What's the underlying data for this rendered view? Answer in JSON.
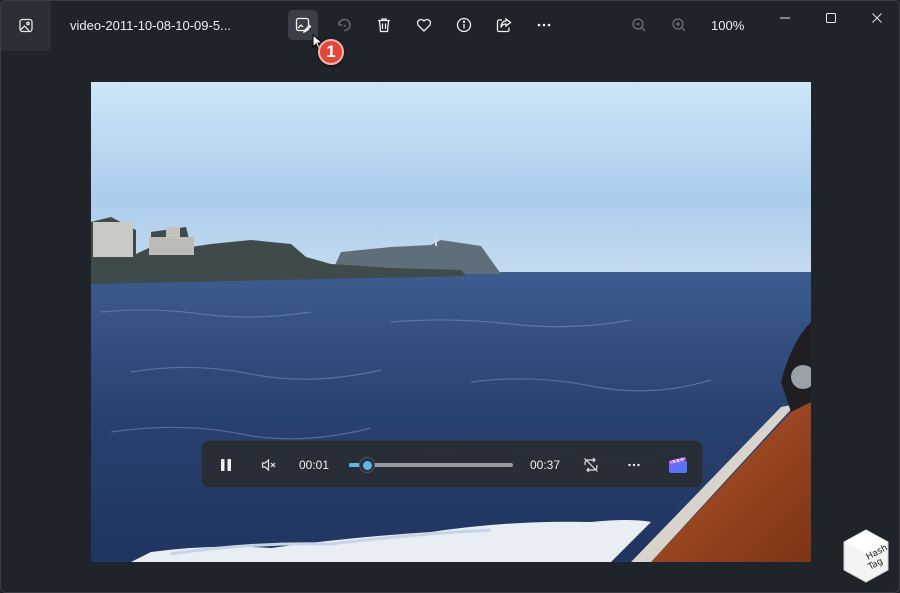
{
  "window": {
    "title": "video-2011-10-08-10-09-5...",
    "zoom": "100%"
  },
  "toolbar": {
    "items": [
      {
        "name": "edit-image-icon",
        "active": true
      },
      {
        "name": "rotate-icon",
        "disabled": true
      },
      {
        "name": "delete-icon"
      },
      {
        "name": "favorite-icon"
      },
      {
        "name": "info-icon"
      },
      {
        "name": "share-icon"
      },
      {
        "name": "more-icon"
      },
      {
        "name": "zoom-out-icon",
        "disabled": true
      },
      {
        "name": "zoom-in-icon",
        "disabled": true
      }
    ]
  },
  "annotation": {
    "step": "1",
    "color": "#e3473c"
  },
  "player": {
    "current_time": "00:01",
    "total_time": "00:37",
    "progress_fraction": 0.027,
    "state": "playing",
    "muted": true,
    "accent": "#60b6f0"
  },
  "watermark": {
    "text_line1": "Hash",
    "text_line2": "Tag"
  }
}
